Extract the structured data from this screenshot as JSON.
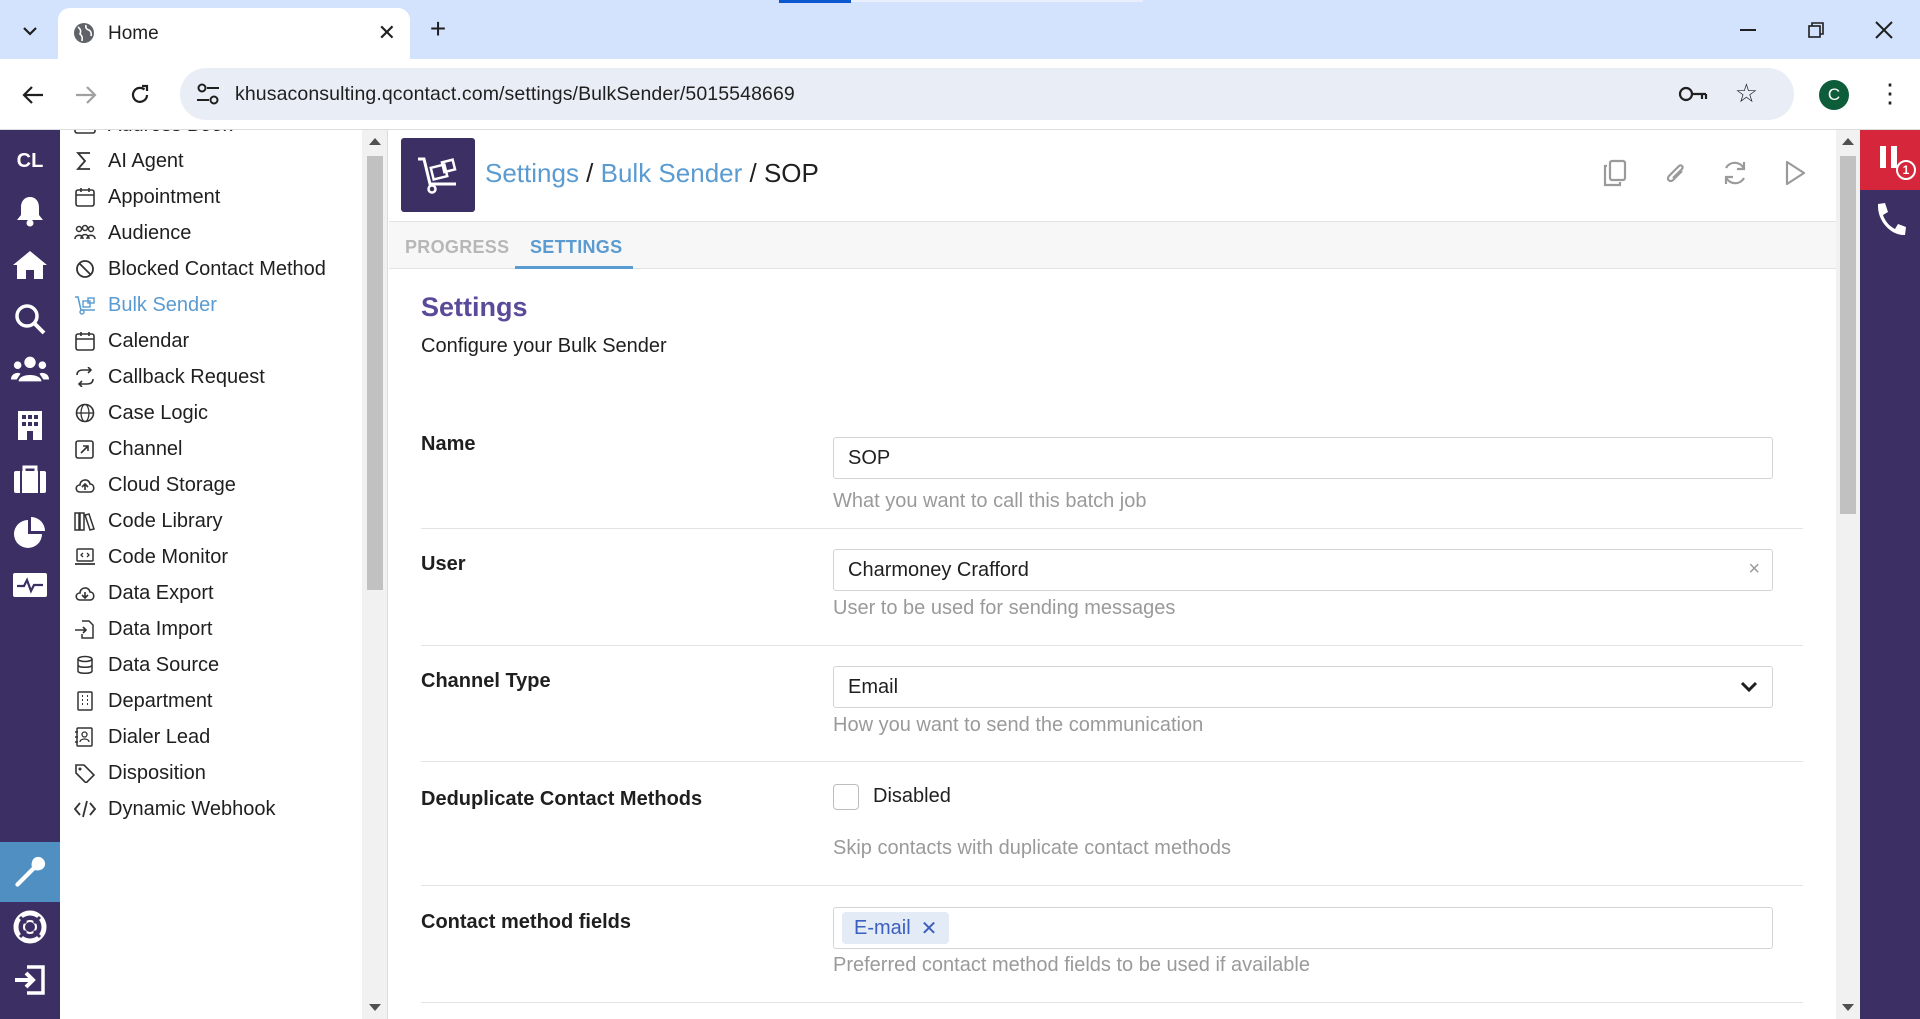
{
  "browser": {
    "tab_title": "Home",
    "url": "khusaconsulting.qcontact.com/settings/BulkSender/5015548669",
    "profile_initial": "C"
  },
  "rail": {
    "brand": "CL",
    "accent_color": "#3b2f63",
    "active_color": "#4f8fc1",
    "icons": [
      "bell-icon",
      "home-icon",
      "search-icon",
      "people-icon",
      "building-icon",
      "briefcase-icon",
      "pie-chart-icon",
      "monitor-icon",
      "wrench-icon",
      "help-ring-icon",
      "logout-icon"
    ]
  },
  "settings_list": {
    "items": [
      {
        "label": "Address Book",
        "icon": "address-card-icon"
      },
      {
        "label": "AI Agent",
        "icon": "sigma-icon"
      },
      {
        "label": "Appointment",
        "icon": "calendar-icon"
      },
      {
        "label": "Audience",
        "icon": "audience-icon"
      },
      {
        "label": "Blocked Contact Method",
        "icon": "ban-icon"
      },
      {
        "label": "Bulk Sender",
        "icon": "dolly-icon"
      },
      {
        "label": "Calendar",
        "icon": "calendar-icon"
      },
      {
        "label": "Callback Request",
        "icon": "repeat-icon"
      },
      {
        "label": "Case Logic",
        "icon": "globe-icon"
      },
      {
        "label": "Channel",
        "icon": "external-square-icon"
      },
      {
        "label": "Cloud Storage",
        "icon": "cloud-upload-icon"
      },
      {
        "label": "Code Library",
        "icon": "books-icon"
      },
      {
        "label": "Code Monitor",
        "icon": "laptop-code-icon"
      },
      {
        "label": "Data Export",
        "icon": "cloud-download-icon"
      },
      {
        "label": "Data Import",
        "icon": "file-import-icon"
      },
      {
        "label": "Data Source",
        "icon": "database-icon"
      },
      {
        "label": "Department",
        "icon": "building-small-icon"
      },
      {
        "label": "Dialer Lead",
        "icon": "contact-book-icon"
      },
      {
        "label": "Disposition",
        "icon": "tag-icon"
      },
      {
        "label": "Dynamic Webhook",
        "icon": "code-icon"
      }
    ],
    "active_label": "Bulk Sender"
  },
  "header": {
    "crumb_settings": "Settings",
    "crumb_sep1": " / ",
    "crumb_bulk": "Bulk Sender",
    "crumb_sep2": " / ",
    "crumb_current": "SOP",
    "actions": [
      "copy-icon",
      "paperclip-icon",
      "refresh-icon",
      "play-icon"
    ]
  },
  "tabs": {
    "progress": "PROGRESS",
    "settings": "SETTINGS",
    "active": "SETTINGS"
  },
  "form": {
    "title": "Settings",
    "subtitle": "Configure your Bulk Sender",
    "name": {
      "label": "Name",
      "value": "SOP",
      "help": "What you want to call this batch job"
    },
    "user": {
      "label": "User",
      "value": "Charmoney Crafford",
      "clear": "×",
      "help": "User to be used for sending messages"
    },
    "channel_type": {
      "label": "Channel Type",
      "value": "Email",
      "help": "How you want to send the communication"
    },
    "dedupe": {
      "label": "Deduplicate Contact Methods",
      "checkbox_label": "Disabled",
      "checked": false,
      "help": "Skip contacts with duplicate contact methods"
    },
    "contact_fields": {
      "label": "Contact method fields",
      "chips": [
        "E-mail"
      ],
      "chip_remove": "✕",
      "help": "Preferred contact method fields to be used if available"
    }
  },
  "right_rail": {
    "badge": "1"
  }
}
